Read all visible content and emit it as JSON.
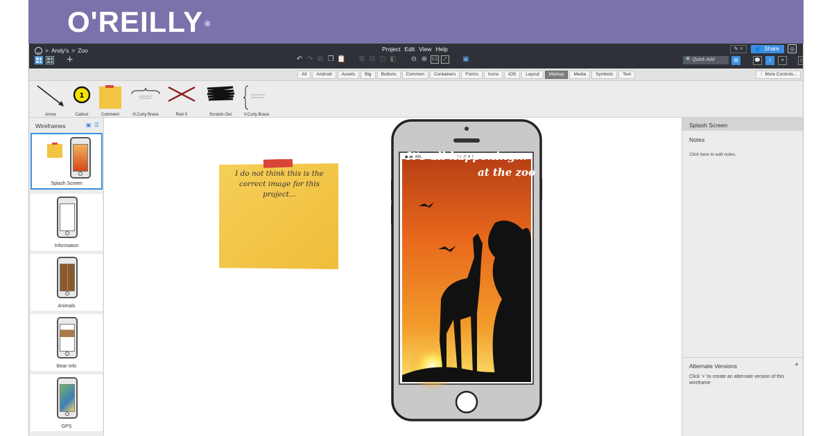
{
  "banner": {
    "logo_text": "O'REILLY",
    "logo_mark": "®",
    "color": "#7a72ab"
  },
  "breadcrumb": {
    "sep1": ">",
    "project": "Andy's",
    "sep2": ">",
    "page": "Zoo"
  },
  "menus": [
    "Project",
    "Edit",
    "View",
    "Help"
  ],
  "header": {
    "share_label": "Share",
    "quick_add_placeholder": "Quick Add"
  },
  "filters": [
    "All",
    "Android",
    "Assets",
    "Big",
    "Buttons",
    "Common",
    "Containers",
    "Forms",
    "Icons",
    "iOS",
    "Layout",
    "Markup",
    "Media",
    "Symbols",
    "Text"
  ],
  "active_filter": "Markup",
  "more_controls": "More Controls...",
  "library": [
    "Arrow",
    "Callout",
    "Comment",
    "H.Curly Brace",
    "Red X",
    "Scratch-Out",
    "V.Curly Brace"
  ],
  "callout_number": "1",
  "wireframes": {
    "title": "Wireframes",
    "items": [
      "Splash Screen",
      "Information",
      "Animals",
      "Bear Info",
      "GPS"
    ]
  },
  "canvas": {
    "note_text": "I do not think this is the correct image for this project...",
    "screen_line1": "It's all happening...",
    "screen_line2": "at the zoo"
  },
  "right_panel": {
    "title": "Splash Screen",
    "notes_label": "Notes",
    "notes_placeholder": "Click here to edit notes.",
    "alt_title": "Alternate Versions",
    "alt_plus": "+",
    "alt_desc": "Click '+' to create an alternate version of this wireframe"
  },
  "colors": {
    "accent": "#3e8ee0",
    "topbar": "#2e3238",
    "sunset": "#e8671c",
    "sticky": "#f2c443"
  }
}
